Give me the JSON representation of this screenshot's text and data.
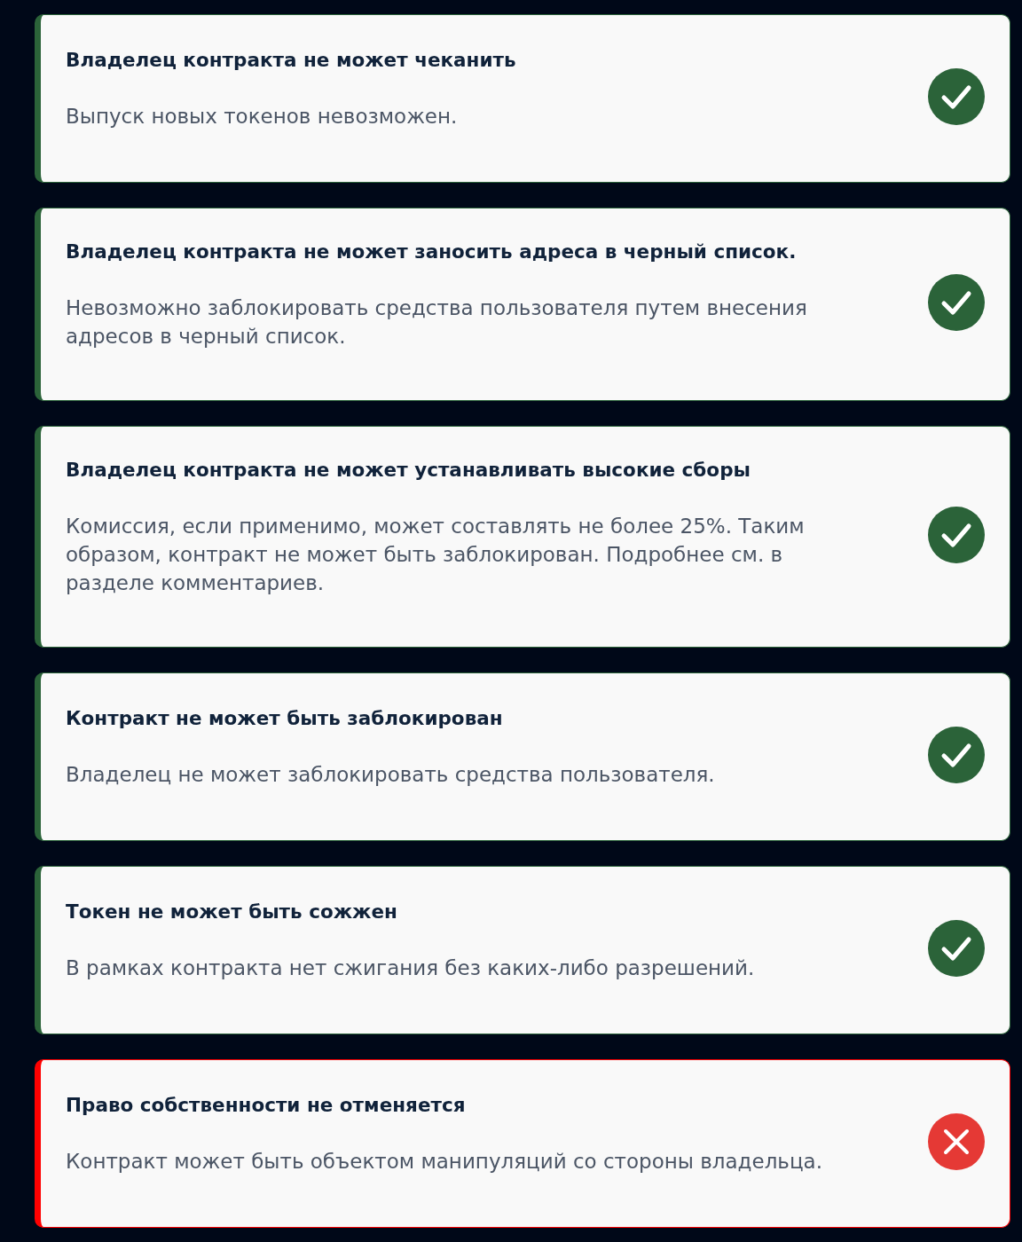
{
  "checks": [
    {
      "kind": "pass",
      "title": "Владелец контракта не может чеканить",
      "description": "Выпуск новых токенов невозможен."
    },
    {
      "kind": "pass",
      "title": "Владелец контракта не может заносить адреса в черный список.",
      "description": "Невозможно заблокировать средства пользователя путем внесения адресов в черный список."
    },
    {
      "kind": "pass",
      "title": "Владелец контракта не может устанавливать высокие сборы",
      "description": "Комиссия, если применимо, может составлять не более 25%. Таким образом, контракт не может быть заблокирован. Подробнее см. в разделе комментариев."
    },
    {
      "kind": "pass",
      "title": "Контракт не может быть заблокирован",
      "description": "Владелец не может заблокировать средства пользователя."
    },
    {
      "kind": "pass",
      "title": "Токен не может быть сожжен",
      "description": "В рамках контракта нет сжигания без каких-либо разрешений."
    },
    {
      "kind": "fail",
      "title": "Право собственности не отменяется",
      "description": "Контракт может быть объектом манипуляций со стороны владельца."
    }
  ]
}
